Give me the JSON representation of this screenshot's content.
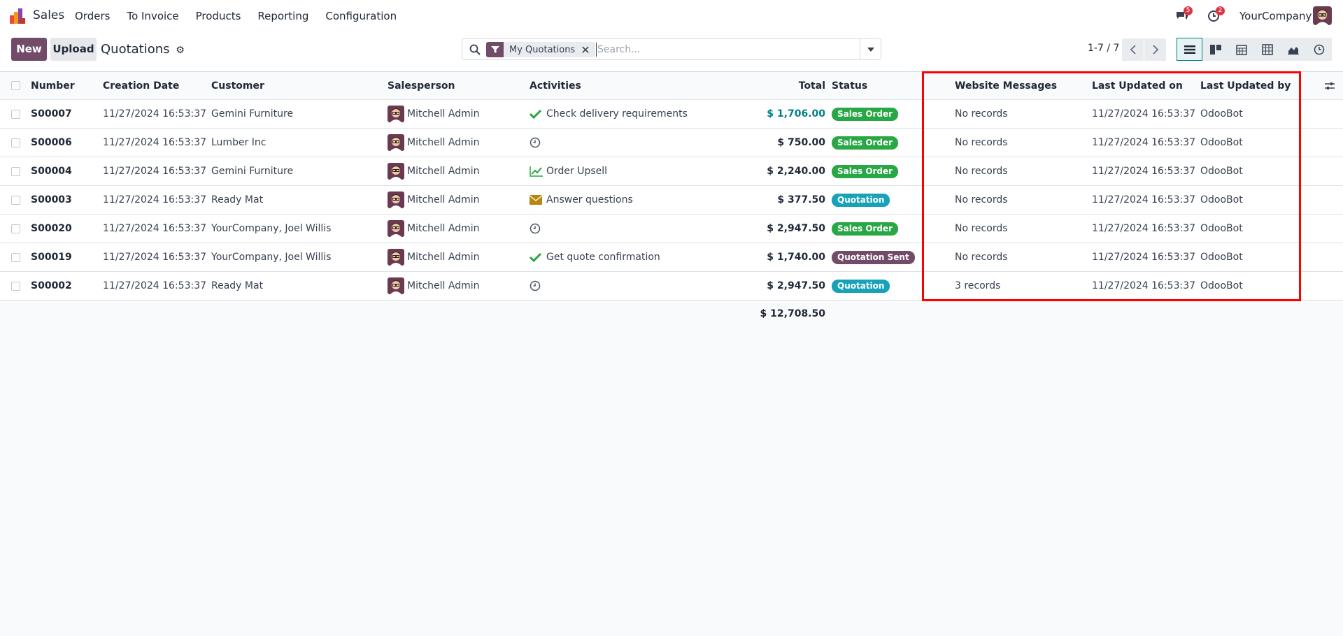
{
  "navbar": {
    "app_name": "Sales",
    "menu": [
      "Orders",
      "To Invoice",
      "Products",
      "Reporting",
      "Configuration"
    ],
    "messages_badge": "5",
    "activities_badge": "2",
    "company": "YourCompany"
  },
  "control": {
    "new_label": "New",
    "upload_label": "Upload",
    "breadcrumb": "Quotations",
    "facet_label": "My Quotations",
    "search_placeholder": "Search...",
    "pager": "1-7 / 7"
  },
  "table": {
    "headers": {
      "number": "Number",
      "creation_date": "Creation Date",
      "customer": "Customer",
      "salesperson": "Salesperson",
      "activities": "Activities",
      "total": "Total",
      "status": "Status",
      "website_messages": "Website Messages",
      "last_updated_on": "Last Updated on",
      "last_updated_by": "Last Updated by"
    },
    "rows": [
      {
        "number": "S00007",
        "date": "11/27/2024 16:53:37",
        "customer": "Gemini Furniture",
        "salesperson": "Mitchell Admin",
        "activity_icon": "check-icon",
        "activity": "Check delivery requirements",
        "total": "$ 1,706.00",
        "status": "Sales Order",
        "messages": "No records",
        "updated_on": "11/27/2024 16:53:37",
        "updated_by": "OdooBot"
      },
      {
        "number": "S00006",
        "date": "11/27/2024 16:53:37",
        "customer": "Lumber Inc",
        "salesperson": "Mitchell Admin",
        "activity_icon": "clock-icon",
        "activity": "",
        "total": "$ 750.00",
        "status": "Sales Order",
        "messages": "No records",
        "updated_on": "11/27/2024 16:53:37",
        "updated_by": "OdooBot"
      },
      {
        "number": "S00004",
        "date": "11/27/2024 16:53:37",
        "customer": "Gemini Furniture",
        "salesperson": "Mitchell Admin",
        "activity_icon": "chart-line-icon",
        "activity": "Order Upsell",
        "total": "$ 2,240.00",
        "status": "Sales Order",
        "messages": "No records",
        "updated_on": "11/27/2024 16:53:37",
        "updated_by": "OdooBot"
      },
      {
        "number": "S00003",
        "date": "11/27/2024 16:53:37",
        "customer": "Ready Mat",
        "salesperson": "Mitchell Admin",
        "activity_icon": "envelope-icon",
        "activity": "Answer questions",
        "total": "$ 377.50",
        "status": "Quotation",
        "messages": "No records",
        "updated_on": "11/27/2024 16:53:37",
        "updated_by": "OdooBot"
      },
      {
        "number": "S00020",
        "date": "11/27/2024 16:53:37",
        "customer": "YourCompany, Joel Willis",
        "salesperson": "Mitchell Admin",
        "activity_icon": "clock-icon",
        "activity": "",
        "total": "$ 2,947.50",
        "status": "Sales Order",
        "messages": "No records",
        "updated_on": "11/27/2024 16:53:37",
        "updated_by": "OdooBot"
      },
      {
        "number": "S00019",
        "date": "11/27/2024 16:53:37",
        "customer": "YourCompany, Joel Willis",
        "salesperson": "Mitchell Admin",
        "activity_icon": "check-icon",
        "activity": "Get quote confirmation",
        "total": "$ 1,740.00",
        "status": "Quotation Sent",
        "messages": "No records",
        "updated_on": "11/27/2024 16:53:37",
        "updated_by": "OdooBot"
      },
      {
        "number": "S00002",
        "date": "11/27/2024 16:53:37",
        "customer": "Ready Mat",
        "salesperson": "Mitchell Admin",
        "activity_icon": "clock-icon",
        "activity": "",
        "total": "$ 2,947.50",
        "status": "Quotation",
        "messages": "3 records",
        "updated_on": "11/27/2024 16:53:37",
        "updated_by": "OdooBot"
      }
    ],
    "grand_total": "$ 12,708.50"
  },
  "colors": {
    "brand": "#714b67",
    "accent": "#017e84",
    "success": "#28a745",
    "info": "#17a2b8",
    "highlight": "#ff0000"
  }
}
